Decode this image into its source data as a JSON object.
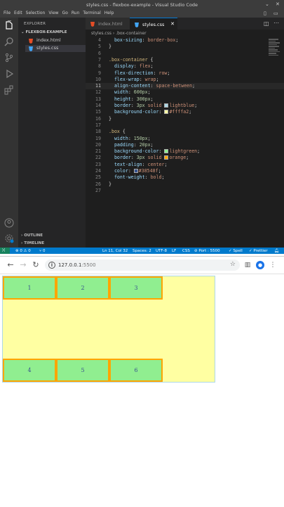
{
  "vscode": {
    "window_title": "styles.css - flexbox-example - Visual Studio Code",
    "menu": [
      "File",
      "Edit",
      "Selection",
      "View",
      "Go",
      "Run",
      "Terminal",
      "Help"
    ],
    "explorer": {
      "header": "EXPLORER",
      "folder": "FLEXBOX-EXAMPLE",
      "files": [
        "index.html",
        "styles.css"
      ],
      "outline": "OUTLINE",
      "timeline": "TIMELINE"
    },
    "tabs": [
      "index.html",
      "styles.css"
    ],
    "breadcrumb": {
      "file": "styles.css",
      "symbol": ".box-container"
    },
    "code": [
      {
        "n": "4",
        "t": "  box-sizing: border-box;"
      },
      {
        "n": "5",
        "t": "}"
      },
      {
        "n": "6",
        "t": ""
      },
      {
        "n": "7",
        "t": ".box-container {"
      },
      {
        "n": "8",
        "t": "  display: flex;"
      },
      {
        "n": "9",
        "t": "  flex-direction: row;"
      },
      {
        "n": "10",
        "t": "  flex-wrap: wrap;"
      },
      {
        "n": "11",
        "t": "  align-content: space-between;"
      },
      {
        "n": "12",
        "t": "  width: 600px;"
      },
      {
        "n": "13",
        "t": "  height: 300px;"
      },
      {
        "n": "14",
        "t": "  border: 3px solid lightblue;"
      },
      {
        "n": "15",
        "t": "  background-color: #ffffa2;"
      },
      {
        "n": "16",
        "t": "}"
      },
      {
        "n": "17",
        "t": ""
      },
      {
        "n": "18",
        "t": ".box {"
      },
      {
        "n": "19",
        "t": "  width: 150px;"
      },
      {
        "n": "20",
        "t": "  padding: 20px;"
      },
      {
        "n": "21",
        "t": "  background-color: lightgreen;"
      },
      {
        "n": "22",
        "t": "  border: 3px solid orange;"
      },
      {
        "n": "23",
        "t": "  text-align: center;"
      },
      {
        "n": "24",
        "t": "  color: #38548f;"
      },
      {
        "n": "25",
        "t": "  font-weight: bold;"
      },
      {
        "n": "26",
        "t": "}"
      },
      {
        "n": "27",
        "t": ""
      }
    ],
    "current_line": "11",
    "status": {
      "problems": "⊗ 0 ⚠ 0",
      "ports": "⑂ 0",
      "position": "Ln 11, Col 32",
      "spaces": "Spaces: 2",
      "encoding": "UTF-8",
      "eol": "LF",
      "language": "CSS",
      "port": "⊘ Port : 5500",
      "spell": "✓ Spell",
      "prettier": "✓ Prettier"
    }
  },
  "browser": {
    "url_host": "127.0.0.1",
    "url_port": ":5500",
    "boxes": [
      "1",
      "2",
      "3",
      "4",
      "5",
      "6"
    ],
    "colors": {
      "container_bg": "#ffffa2",
      "container_border": "lightblue",
      "box_bg": "lightgreen",
      "box_border": "orange",
      "box_text": "#38548f"
    }
  }
}
